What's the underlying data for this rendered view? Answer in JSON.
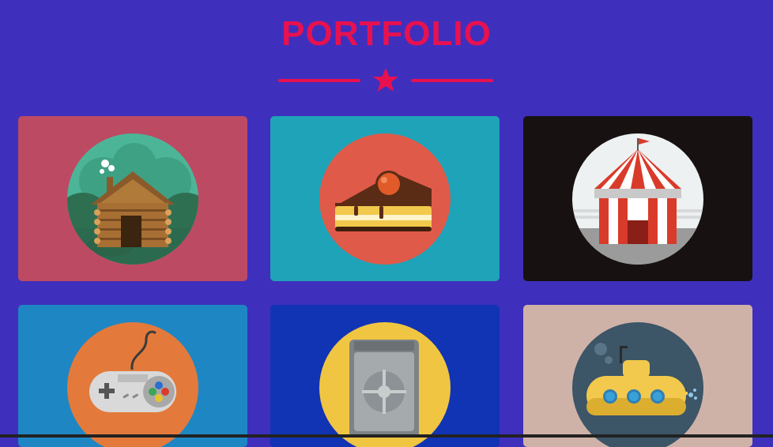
{
  "header": {
    "title": "PORTFOLIO"
  },
  "colors": {
    "accent": "#e8114f",
    "background": "#3f2fbd"
  },
  "portfolio": {
    "items": [
      {
        "icon": "log-cabin-icon",
        "bg": "#bd4a63"
      },
      {
        "icon": "cake-slice-icon",
        "bg": "#1fa3b8"
      },
      {
        "icon": "circus-tent-icon",
        "bg": "#171211"
      },
      {
        "icon": "game-controller-icon",
        "bg": "#1f86c4"
      },
      {
        "icon": "safe-vault-icon",
        "bg": "#1134b4"
      },
      {
        "icon": "submarine-icon",
        "bg": "#cfb2a7"
      }
    ]
  }
}
